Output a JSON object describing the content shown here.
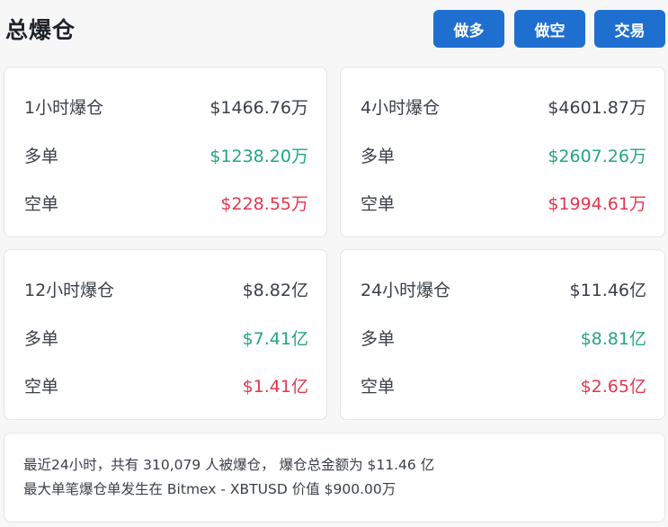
{
  "header": {
    "title": "总爆仓",
    "buttons": {
      "long": "做多",
      "short": "做空",
      "trade": "交易"
    }
  },
  "cards": [
    {
      "period": "1小时爆仓",
      "total": "$1466.76万",
      "long_label": "多单",
      "long_value": "$1238.20万",
      "short_label": "空单",
      "short_value": "$228.55万"
    },
    {
      "period": "4小时爆仓",
      "total": "$4601.87万",
      "long_label": "多单",
      "long_value": "$2607.26万",
      "short_label": "空单",
      "short_value": "$1994.61万"
    },
    {
      "period": "12小时爆仓",
      "total": "$8.82亿",
      "long_label": "多单",
      "long_value": "$7.41亿",
      "short_label": "空单",
      "short_value": "$1.41亿"
    },
    {
      "period": "24小时爆仓",
      "total": "$11.46亿",
      "long_label": "多单",
      "long_value": "$8.81亿",
      "short_label": "空单",
      "short_value": "$2.65亿"
    }
  ],
  "summary": {
    "line1": "最近24小时，共有 310,079 人被爆仓， 爆仓总金额为 $11.46 亿",
    "line2": "最大单笔爆仓单发生在 Bitmex - XBTUSD 价值 $900.00万"
  },
  "colors": {
    "accent": "#1f6fd1",
    "long": "#26a483",
    "short": "#e5364f"
  }
}
